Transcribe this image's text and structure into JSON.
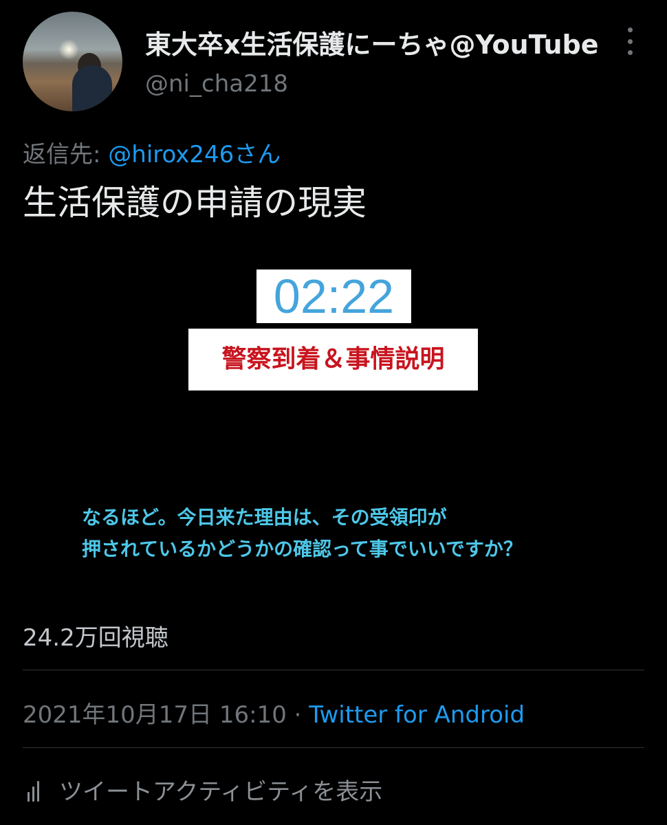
{
  "user": {
    "display_name": "東大卒x生活保護にーちゃ@YouTube",
    "handle": "@ni_cha218"
  },
  "reply": {
    "prefix": "返信先: ",
    "mention": "@hirox246さん"
  },
  "tweet": {
    "text": "生活保護の申請の現実"
  },
  "video": {
    "timer": "02:22",
    "caption": "警察到着＆事情説明",
    "subtitle_line1": "なるほど。今日来た理由は、その受領印が",
    "subtitle_line2": "押されているかどうかの確認って事でいいですか？"
  },
  "stats": {
    "views": "24.2万回視聴"
  },
  "meta": {
    "datetime": "2021年10月17日 16:10",
    "separator": " · ",
    "source": "Twitter for Android"
  },
  "actions": {
    "activity_label": "ツイートアクティビティを表示"
  },
  "colors": {
    "background": "#000000",
    "text": "#e7e9ea",
    "muted": "#71767b",
    "link": "#1d9bf0",
    "caption_red": "#c8141e",
    "subtitle_cyan": "#4ec7e8"
  },
  "icons": {
    "more": "more-vertical-icon",
    "activity": "bar-chart-icon"
  }
}
